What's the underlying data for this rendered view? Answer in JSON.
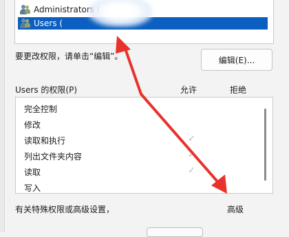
{
  "groups": [
    {
      "name": "Administrators (",
      "selected": false
    },
    {
      "name": "Users (",
      "selected": true
    }
  ],
  "hint": "要更改权限，请单击“编辑”。",
  "edit_button": "编辑(E)...",
  "perm_header": {
    "title": "Users 的权限(P)",
    "allow": "允许",
    "deny": "拒绝"
  },
  "permissions": [
    {
      "name": "完全控制",
      "allow": false
    },
    {
      "name": "修改",
      "allow": false
    },
    {
      "name": "读取和执行",
      "allow": true
    },
    {
      "name": "列出文件夹内容",
      "allow": true
    },
    {
      "name": "读取",
      "allow": true
    },
    {
      "name": "写入",
      "allow": false
    }
  ],
  "special_text": "有关特殊权限或高级设置，",
  "advanced_label": "高级",
  "check_glyph": "✓",
  "colors": {
    "selection": "#0b5fc0",
    "arrow": "#e8322c",
    "check": "#b9b9b9"
  }
}
